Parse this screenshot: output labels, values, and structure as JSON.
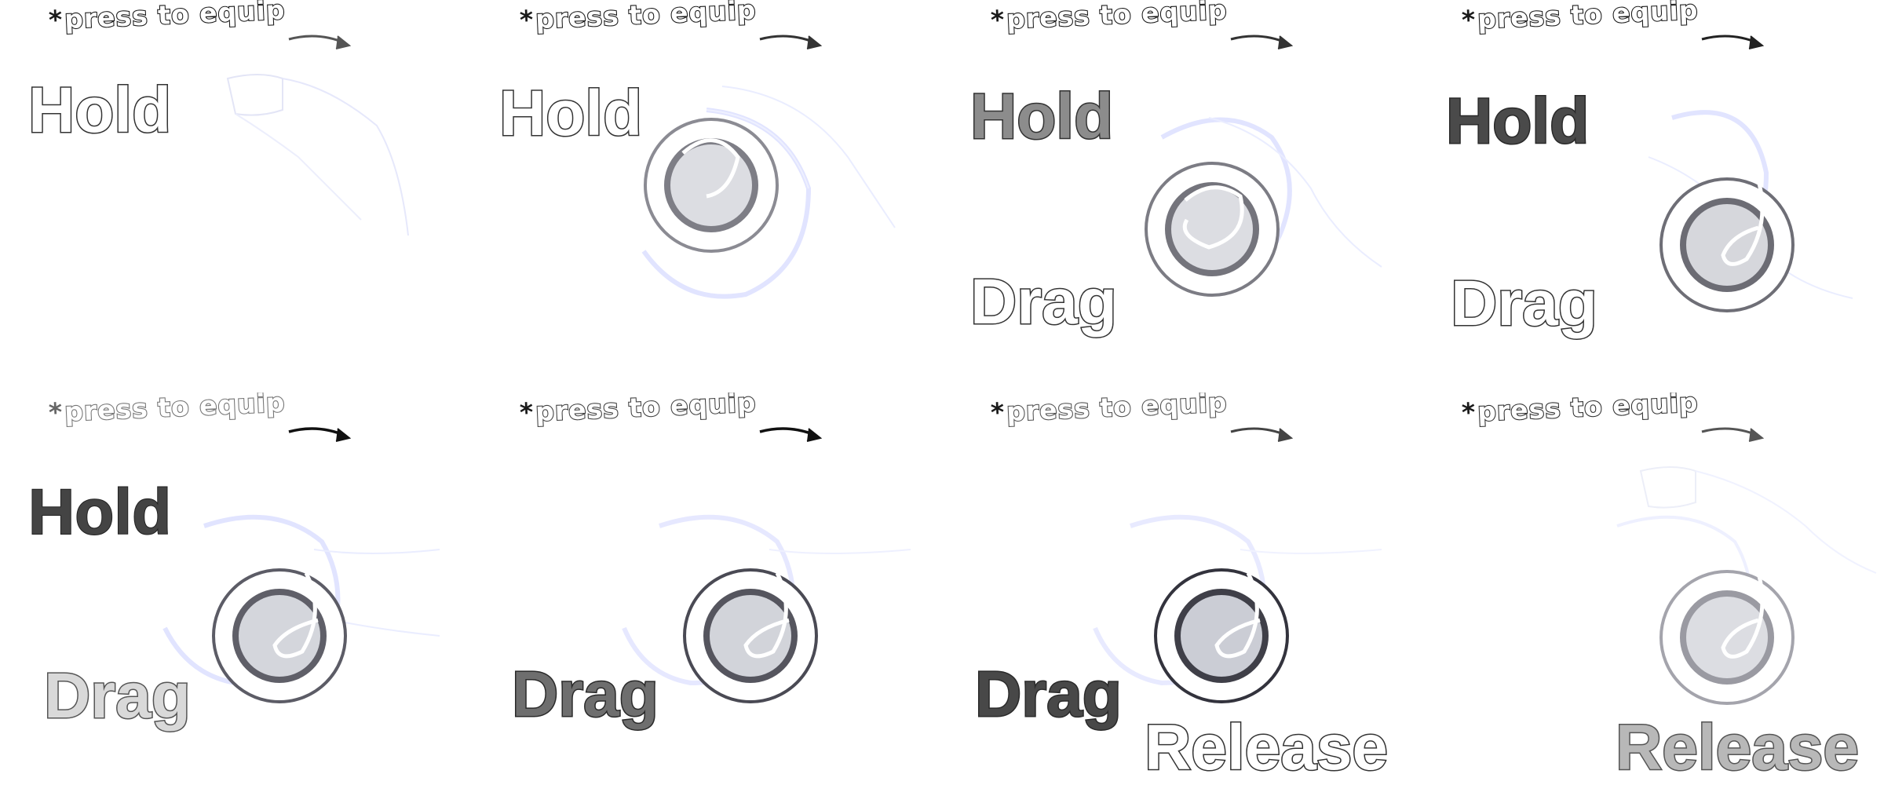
{
  "panels": [
    {
      "hint": "press to equip",
      "words": {
        "hold": "Hold"
      }
    },
    {
      "hint": "press to equip",
      "words": {
        "hold": "Hold"
      }
    },
    {
      "hint": "press to equip",
      "words": {
        "hold": "Hold",
        "drag": "Drag"
      }
    },
    {
      "hint": "press to equip",
      "words": {
        "hold": "Hold",
        "drag": "Drag"
      }
    },
    {
      "hint": "press to equip",
      "words": {
        "hold": "Hold",
        "drag": "Drag"
      }
    },
    {
      "hint": "press to equip",
      "words": {
        "drag": "Drag"
      }
    },
    {
      "hint": "press to equip",
      "words": {
        "drag": "Drag",
        "release": "Release"
      }
    },
    {
      "hint": "press to equip",
      "words": {
        "release": "Release"
      }
    }
  ],
  "hint_marker": "*",
  "colors": {
    "background": "#ffffff",
    "button_fill": "#dcdde2",
    "button_ring": "#6e6e78",
    "glow": "#cfd3ff",
    "text_outline": "#333333"
  },
  "icons": [
    "asterisk-icon",
    "curved-arrow-icon",
    "joystick-button-icon",
    "hand-ghost-icon"
  ]
}
